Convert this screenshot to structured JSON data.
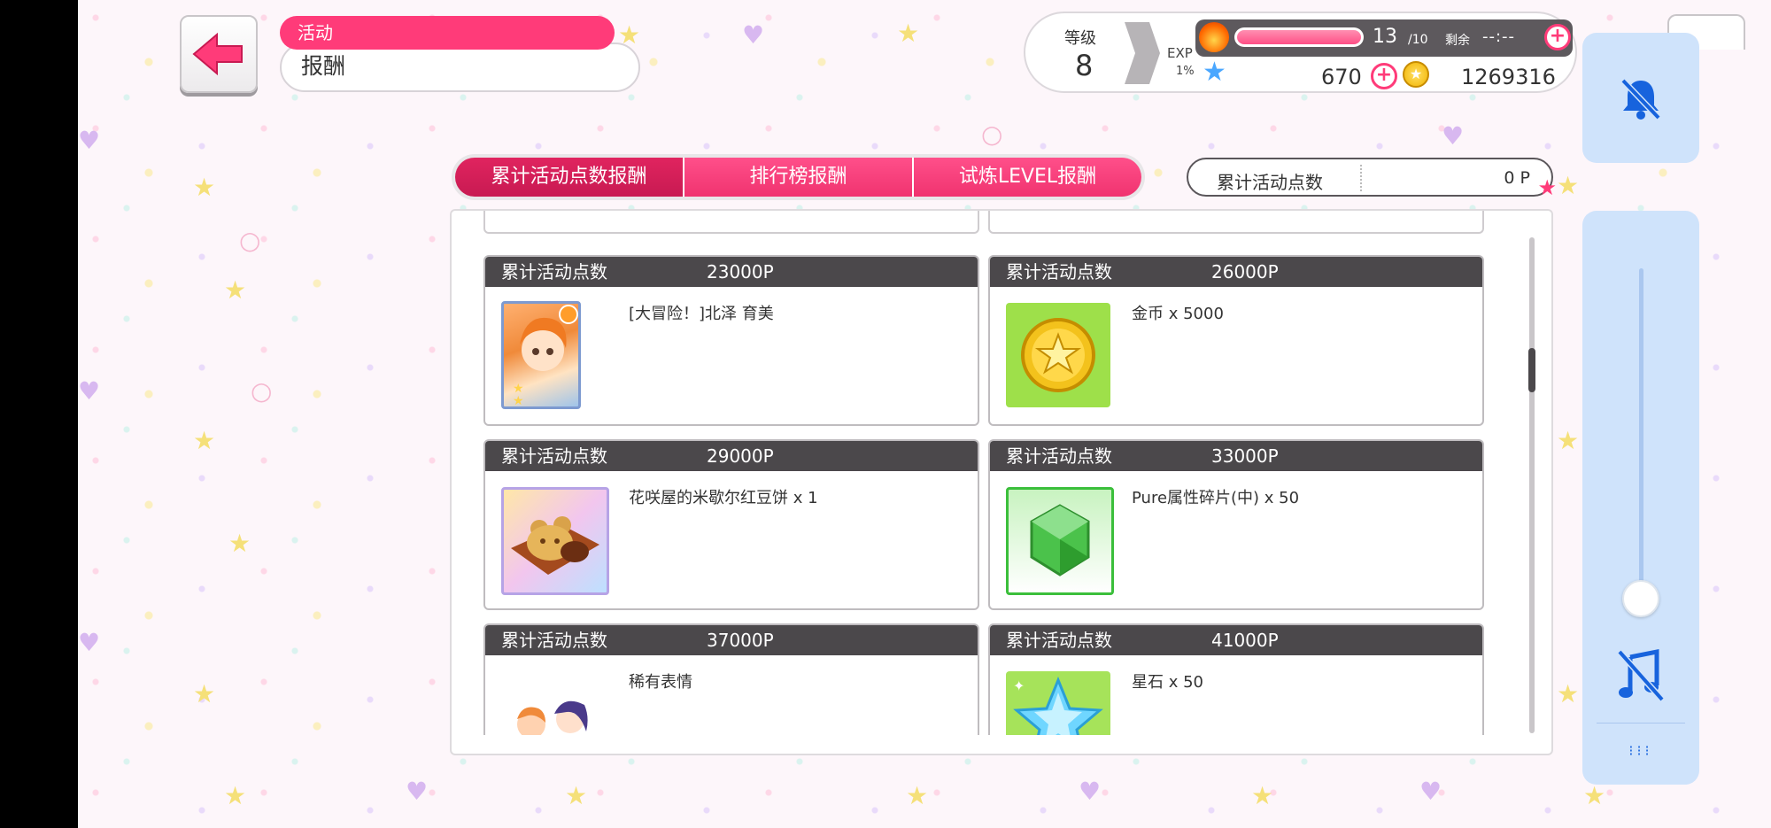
{
  "header": {
    "back_icon": "arrow-left-icon",
    "category": "活动",
    "title": "报酬"
  },
  "status": {
    "level_label": "等级",
    "level": "8",
    "exp_label": "EXP",
    "exp_percent": "1%",
    "stamina": "13",
    "stamina_max": "/10",
    "remaining_label": "剩余",
    "remaining_time": "--:--",
    "gems": "670",
    "coins": "1269316"
  },
  "tabs": [
    "累计活动点数报酬",
    "排行榜报酬",
    "试炼LEVEL报酬"
  ],
  "points": {
    "label": "累计活动点数",
    "value": "0 P"
  },
  "rewards": [
    {
      "label": "累计活动点数",
      "points": "23000P",
      "name": "[大冒险！]北泽 育美",
      "icon": "character-card-icon"
    },
    {
      "label": "累计活动点数",
      "points": "26000P",
      "name": "金币 x 5000",
      "icon": "gold-coin-icon"
    },
    {
      "label": "累计活动点数",
      "points": "29000P",
      "name": "花咲屋的米歇尔红豆饼 x 1",
      "icon": "bear-cake-icon"
    },
    {
      "label": "累计活动点数",
      "points": "33000P",
      "name": "Pure属性碎片(中) x 50",
      "icon": "pure-shard-icon"
    },
    {
      "label": "累计活动点数",
      "points": "37000P",
      "name": "稀有表情",
      "icon": "rare-stamp-icon"
    },
    {
      "label": "累计活动点数",
      "points": "41000P",
      "name": "星石 x 50",
      "icon": "star-stone-icon"
    }
  ],
  "overlay": {
    "bell_icon": "bell-off-icon",
    "music_icon": "music-off-icon",
    "slider_level": 0.05,
    "more_icon": "more-dots-icon"
  },
  "colors": {
    "accent": "#ff3b79",
    "card_header": "#4b484b",
    "overlay_panel": "#cfe3fb",
    "overlay_icon": "#1763dd"
  }
}
